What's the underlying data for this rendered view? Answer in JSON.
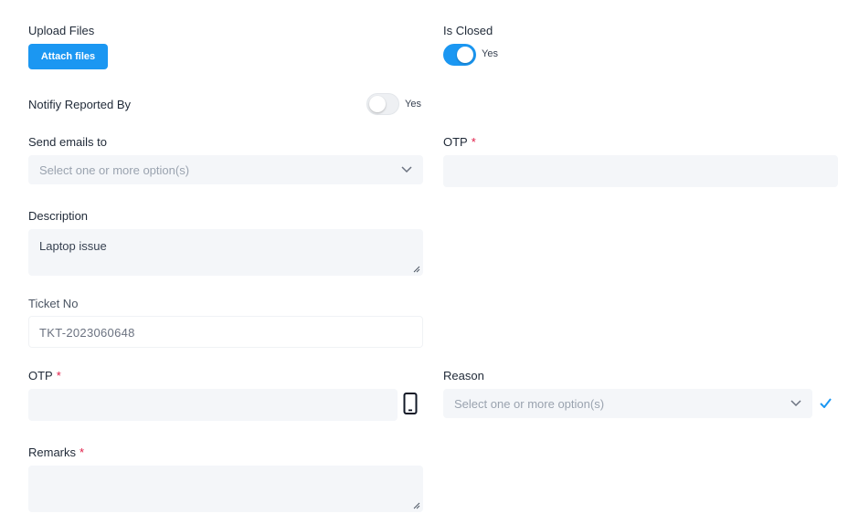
{
  "upload": {
    "label": "Upload Files",
    "button": "Attach files"
  },
  "is_closed": {
    "label": "Is Closed",
    "toggle_label": "Yes",
    "state": "on"
  },
  "notify": {
    "label": "Notifiy Reported By",
    "toggle_label": "Yes",
    "state": "off"
  },
  "send_emails": {
    "label": "Send emails to",
    "placeholder": "Select one or more option(s)"
  },
  "otp_top": {
    "label": "OTP",
    "required": "*",
    "value": ""
  },
  "description": {
    "label": "Description",
    "value": "Laptop issue"
  },
  "ticket": {
    "label": "Ticket No",
    "value": "TKT-2023060648"
  },
  "otp_bottom": {
    "label": "OTP",
    "required": "*",
    "value": "",
    "icon": "mobile-phone-icon"
  },
  "reason": {
    "label": "Reason",
    "placeholder": "Select one or more option(s)",
    "check_icon": "checkmark-icon"
  },
  "remarks": {
    "label": "Remarks",
    "required": "*",
    "value": ""
  },
  "colors": {
    "accent": "#1b97f2",
    "required": "#e11d48",
    "field_bg": "#f4f6f9"
  }
}
